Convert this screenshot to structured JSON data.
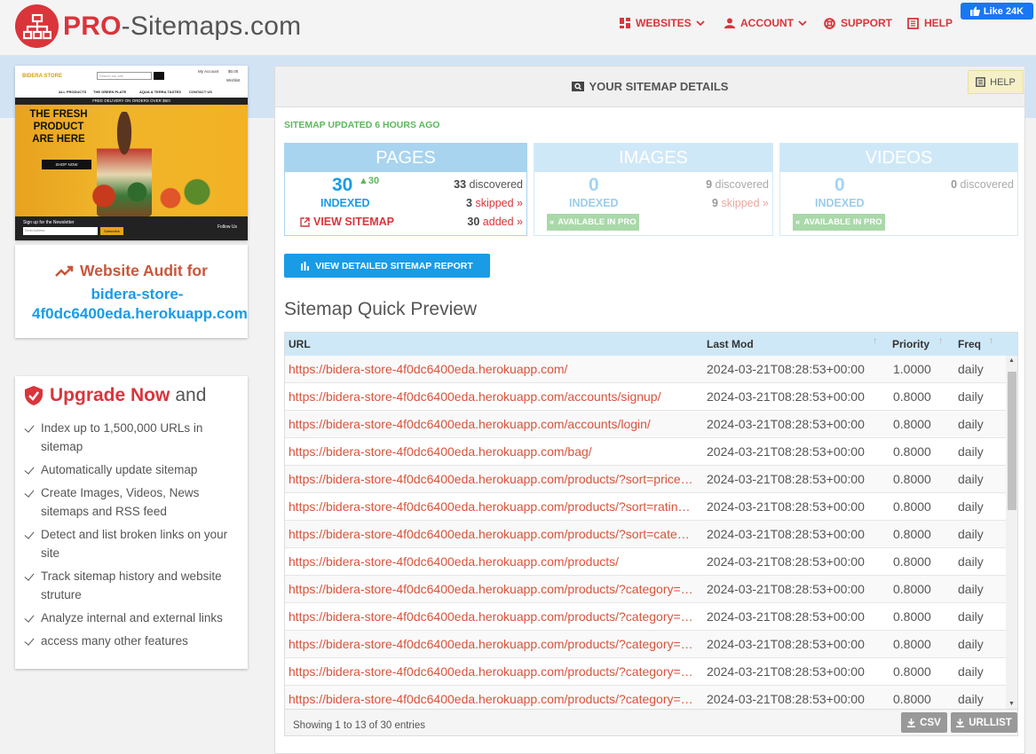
{
  "brand": {
    "pro": "PRO",
    "rest": "-Sitemaps.com"
  },
  "nav": {
    "websites": "WEBSITES",
    "account": "ACCOUNT",
    "support": "SUPPORT",
    "help": "HELP"
  },
  "like": {
    "label": "Like 24K"
  },
  "preview": {
    "store_name": "BIDERA STORE",
    "search_placeholder": "Search our site",
    "account": "My Account",
    "wishlist": "Wishlist",
    "bag_count": "$0.00",
    "menu": [
      "ALL PRODUCTS",
      "THE GREEN PLATE",
      "AQUA & TERRA TASTES",
      "CONTACT US"
    ],
    "promo": "FREE DELIVERY ON ORDERS OVER $50!",
    "hero": "THE FRESH PRODUCT ARE HERE",
    "shop": "SHOP NOW",
    "newsletter": "Sign up for the Newsletter",
    "email_ph": "Email Address",
    "subscribe": "Subscribe",
    "follow": "Follow Us"
  },
  "audit": {
    "title": "Website Audit for",
    "domain": "bidera-store-4f0dc6400eda.herokuapp.com"
  },
  "upgrade": {
    "title": "Upgrade Now",
    "and": "and",
    "items": [
      "Index up to 1,500,000 URLs in sitemap",
      "Automatically update sitemap",
      "Create Images, Videos, News sitemaps and RSS feed",
      "Detect and list broken links on your site",
      "Track sitemap history and website struture",
      "Analyze internal and external links",
      "access many other features"
    ]
  },
  "main": {
    "title": "YOUR SITEMAP DETAILS",
    "help": "HELP",
    "updated": "SITEMAP UPDATED 6 HOURS AGO",
    "pages": {
      "title": "PAGES",
      "count": "30",
      "delta": "30",
      "indexed": "INDEXED",
      "view": "VIEW SITEMAP",
      "discovered_n": "33",
      "discovered": "discovered",
      "skipped_n": "3",
      "skipped": "skipped",
      "added_n": "30",
      "added": "added"
    },
    "images": {
      "title": "IMAGES",
      "count": "0",
      "indexed": "INDEXED",
      "discovered_n": "9",
      "discovered": "discovered",
      "skipped_n": "9",
      "skipped": "skipped",
      "pro": "AVAILABLE IN PRO"
    },
    "videos": {
      "title": "VIDEOS",
      "count": "0",
      "indexed": "INDEXED",
      "discovered_n": "0",
      "discovered": "discovered",
      "pro": "AVAILABLE IN PRO"
    },
    "report_btn": "VIEW DETAILED SITEMAP REPORT",
    "quick_preview": "Sitemap Quick Preview"
  },
  "table": {
    "headers": {
      "url": "URL",
      "lastmod": "Last Mod",
      "priority": "Priority",
      "freq": "Freq"
    },
    "rows": [
      {
        "url": "https://bidera-store-4f0dc6400eda.herokuapp.com/",
        "lastmod": "2024-03-21T08:28:53+00:00",
        "priority": "1.0000",
        "freq": "daily"
      },
      {
        "url": "https://bidera-store-4f0dc6400eda.herokuapp.com/accounts/signup/",
        "lastmod": "2024-03-21T08:28:53+00:00",
        "priority": "0.8000",
        "freq": "daily"
      },
      {
        "url": "https://bidera-store-4f0dc6400eda.herokuapp.com/accounts/login/",
        "lastmod": "2024-03-21T08:28:53+00:00",
        "priority": "0.8000",
        "freq": "daily"
      },
      {
        "url": "https://bidera-store-4f0dc6400eda.herokuapp.com/bag/",
        "lastmod": "2024-03-21T08:28:53+00:00",
        "priority": "0.8000",
        "freq": "daily"
      },
      {
        "url": "https://bidera-store-4f0dc6400eda.herokuapp.com/products/?sort=price…",
        "lastmod": "2024-03-21T08:28:53+00:00",
        "priority": "0.8000",
        "freq": "daily"
      },
      {
        "url": "https://bidera-store-4f0dc6400eda.herokuapp.com/products/?sort=ratin…",
        "lastmod": "2024-03-21T08:28:53+00:00",
        "priority": "0.8000",
        "freq": "daily"
      },
      {
        "url": "https://bidera-store-4f0dc6400eda.herokuapp.com/products/?sort=cate…",
        "lastmod": "2024-03-21T08:28:53+00:00",
        "priority": "0.8000",
        "freq": "daily"
      },
      {
        "url": "https://bidera-store-4f0dc6400eda.herokuapp.com/products/",
        "lastmod": "2024-03-21T08:28:53+00:00",
        "priority": "0.8000",
        "freq": "daily"
      },
      {
        "url": "https://bidera-store-4f0dc6400eda.herokuapp.com/products/?category=…",
        "lastmod": "2024-03-21T08:28:53+00:00",
        "priority": "0.8000",
        "freq": "daily"
      },
      {
        "url": "https://bidera-store-4f0dc6400eda.herokuapp.com/products/?category=…",
        "lastmod": "2024-03-21T08:28:53+00:00",
        "priority": "0.8000",
        "freq": "daily"
      },
      {
        "url": "https://bidera-store-4f0dc6400eda.herokuapp.com/products/?category=…",
        "lastmod": "2024-03-21T08:28:53+00:00",
        "priority": "0.8000",
        "freq": "daily"
      },
      {
        "url": "https://bidera-store-4f0dc6400eda.herokuapp.com/products/?category=…",
        "lastmod": "2024-03-21T08:28:53+00:00",
        "priority": "0.8000",
        "freq": "daily"
      },
      {
        "url": "https://bidera-store-4f0dc6400eda.herokuapp.com/products/?category=…",
        "lastmod": "2024-03-21T08:28:53+00:00",
        "priority": "0.8000",
        "freq": "daily"
      }
    ],
    "showing": "Showing 1 to 13 of 30 entries",
    "csv": "CSV",
    "urllist": "URLLIST"
  },
  "colors": {
    "brand_red": "#d9353b",
    "accent_blue": "#1a9be6",
    "green": "#5cb85c"
  }
}
